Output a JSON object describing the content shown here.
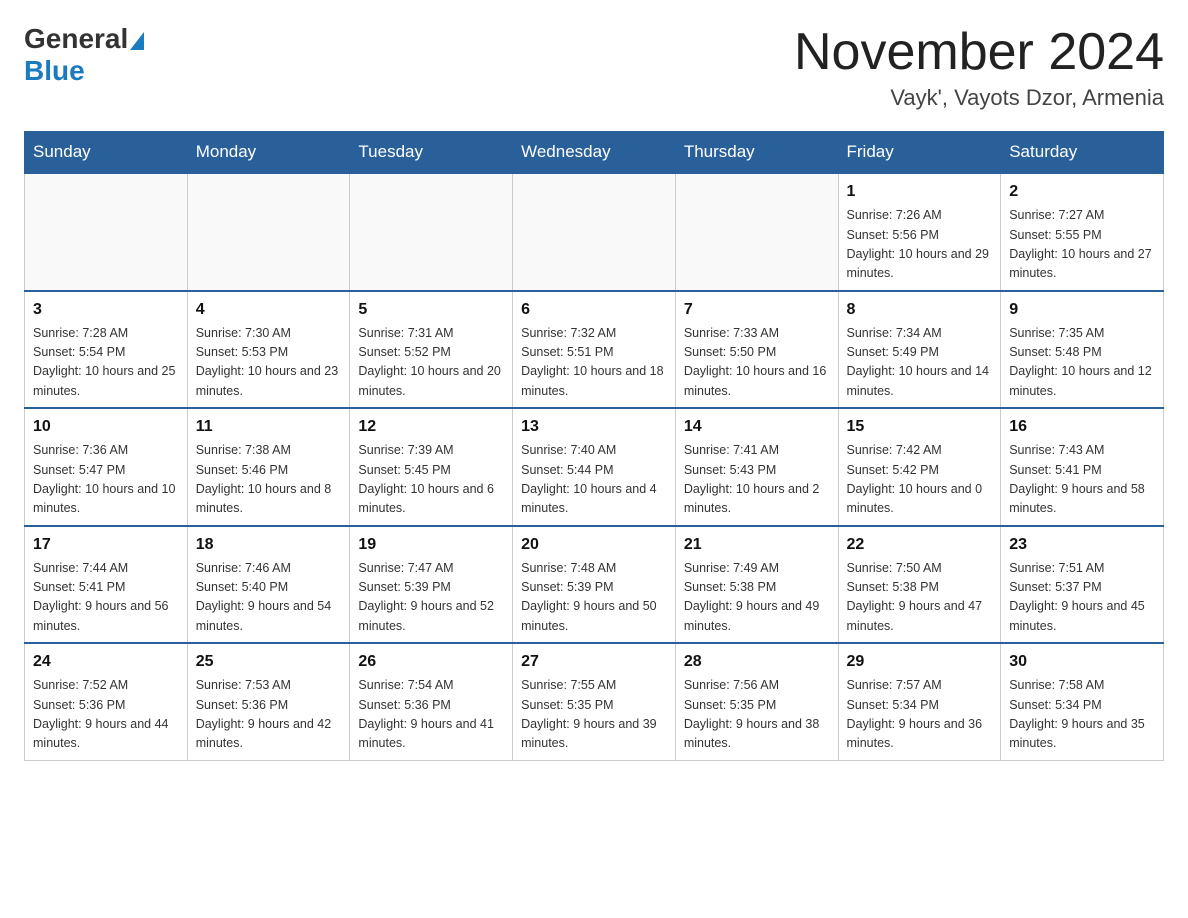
{
  "header": {
    "logo_general": "General",
    "logo_blue": "Blue",
    "month_title": "November 2024",
    "location": "Vayk', Vayots Dzor, Armenia"
  },
  "weekdays": [
    "Sunday",
    "Monday",
    "Tuesday",
    "Wednesday",
    "Thursday",
    "Friday",
    "Saturday"
  ],
  "weeks": [
    [
      {
        "day": "",
        "sunrise": "",
        "sunset": "",
        "daylight": ""
      },
      {
        "day": "",
        "sunrise": "",
        "sunset": "",
        "daylight": ""
      },
      {
        "day": "",
        "sunrise": "",
        "sunset": "",
        "daylight": ""
      },
      {
        "day": "",
        "sunrise": "",
        "sunset": "",
        "daylight": ""
      },
      {
        "day": "",
        "sunrise": "",
        "sunset": "",
        "daylight": ""
      },
      {
        "day": "1",
        "sunrise": "Sunrise: 7:26 AM",
        "sunset": "Sunset: 5:56 PM",
        "daylight": "Daylight: 10 hours and 29 minutes."
      },
      {
        "day": "2",
        "sunrise": "Sunrise: 7:27 AM",
        "sunset": "Sunset: 5:55 PM",
        "daylight": "Daylight: 10 hours and 27 minutes."
      }
    ],
    [
      {
        "day": "3",
        "sunrise": "Sunrise: 7:28 AM",
        "sunset": "Sunset: 5:54 PM",
        "daylight": "Daylight: 10 hours and 25 minutes."
      },
      {
        "day": "4",
        "sunrise": "Sunrise: 7:30 AM",
        "sunset": "Sunset: 5:53 PM",
        "daylight": "Daylight: 10 hours and 23 minutes."
      },
      {
        "day": "5",
        "sunrise": "Sunrise: 7:31 AM",
        "sunset": "Sunset: 5:52 PM",
        "daylight": "Daylight: 10 hours and 20 minutes."
      },
      {
        "day": "6",
        "sunrise": "Sunrise: 7:32 AM",
        "sunset": "Sunset: 5:51 PM",
        "daylight": "Daylight: 10 hours and 18 minutes."
      },
      {
        "day": "7",
        "sunrise": "Sunrise: 7:33 AM",
        "sunset": "Sunset: 5:50 PM",
        "daylight": "Daylight: 10 hours and 16 minutes."
      },
      {
        "day": "8",
        "sunrise": "Sunrise: 7:34 AM",
        "sunset": "Sunset: 5:49 PM",
        "daylight": "Daylight: 10 hours and 14 minutes."
      },
      {
        "day": "9",
        "sunrise": "Sunrise: 7:35 AM",
        "sunset": "Sunset: 5:48 PM",
        "daylight": "Daylight: 10 hours and 12 minutes."
      }
    ],
    [
      {
        "day": "10",
        "sunrise": "Sunrise: 7:36 AM",
        "sunset": "Sunset: 5:47 PM",
        "daylight": "Daylight: 10 hours and 10 minutes."
      },
      {
        "day": "11",
        "sunrise": "Sunrise: 7:38 AM",
        "sunset": "Sunset: 5:46 PM",
        "daylight": "Daylight: 10 hours and 8 minutes."
      },
      {
        "day": "12",
        "sunrise": "Sunrise: 7:39 AM",
        "sunset": "Sunset: 5:45 PM",
        "daylight": "Daylight: 10 hours and 6 minutes."
      },
      {
        "day": "13",
        "sunrise": "Sunrise: 7:40 AM",
        "sunset": "Sunset: 5:44 PM",
        "daylight": "Daylight: 10 hours and 4 minutes."
      },
      {
        "day": "14",
        "sunrise": "Sunrise: 7:41 AM",
        "sunset": "Sunset: 5:43 PM",
        "daylight": "Daylight: 10 hours and 2 minutes."
      },
      {
        "day": "15",
        "sunrise": "Sunrise: 7:42 AM",
        "sunset": "Sunset: 5:42 PM",
        "daylight": "Daylight: 10 hours and 0 minutes."
      },
      {
        "day": "16",
        "sunrise": "Sunrise: 7:43 AM",
        "sunset": "Sunset: 5:41 PM",
        "daylight": "Daylight: 9 hours and 58 minutes."
      }
    ],
    [
      {
        "day": "17",
        "sunrise": "Sunrise: 7:44 AM",
        "sunset": "Sunset: 5:41 PM",
        "daylight": "Daylight: 9 hours and 56 minutes."
      },
      {
        "day": "18",
        "sunrise": "Sunrise: 7:46 AM",
        "sunset": "Sunset: 5:40 PM",
        "daylight": "Daylight: 9 hours and 54 minutes."
      },
      {
        "day": "19",
        "sunrise": "Sunrise: 7:47 AM",
        "sunset": "Sunset: 5:39 PM",
        "daylight": "Daylight: 9 hours and 52 minutes."
      },
      {
        "day": "20",
        "sunrise": "Sunrise: 7:48 AM",
        "sunset": "Sunset: 5:39 PM",
        "daylight": "Daylight: 9 hours and 50 minutes."
      },
      {
        "day": "21",
        "sunrise": "Sunrise: 7:49 AM",
        "sunset": "Sunset: 5:38 PM",
        "daylight": "Daylight: 9 hours and 49 minutes."
      },
      {
        "day": "22",
        "sunrise": "Sunrise: 7:50 AM",
        "sunset": "Sunset: 5:38 PM",
        "daylight": "Daylight: 9 hours and 47 minutes."
      },
      {
        "day": "23",
        "sunrise": "Sunrise: 7:51 AM",
        "sunset": "Sunset: 5:37 PM",
        "daylight": "Daylight: 9 hours and 45 minutes."
      }
    ],
    [
      {
        "day": "24",
        "sunrise": "Sunrise: 7:52 AM",
        "sunset": "Sunset: 5:36 PM",
        "daylight": "Daylight: 9 hours and 44 minutes."
      },
      {
        "day": "25",
        "sunrise": "Sunrise: 7:53 AM",
        "sunset": "Sunset: 5:36 PM",
        "daylight": "Daylight: 9 hours and 42 minutes."
      },
      {
        "day": "26",
        "sunrise": "Sunrise: 7:54 AM",
        "sunset": "Sunset: 5:36 PM",
        "daylight": "Daylight: 9 hours and 41 minutes."
      },
      {
        "day": "27",
        "sunrise": "Sunrise: 7:55 AM",
        "sunset": "Sunset: 5:35 PM",
        "daylight": "Daylight: 9 hours and 39 minutes."
      },
      {
        "day": "28",
        "sunrise": "Sunrise: 7:56 AM",
        "sunset": "Sunset: 5:35 PM",
        "daylight": "Daylight: 9 hours and 38 minutes."
      },
      {
        "day": "29",
        "sunrise": "Sunrise: 7:57 AM",
        "sunset": "Sunset: 5:34 PM",
        "daylight": "Daylight: 9 hours and 36 minutes."
      },
      {
        "day": "30",
        "sunrise": "Sunrise: 7:58 AM",
        "sunset": "Sunset: 5:34 PM",
        "daylight": "Daylight: 9 hours and 35 minutes."
      }
    ]
  ]
}
